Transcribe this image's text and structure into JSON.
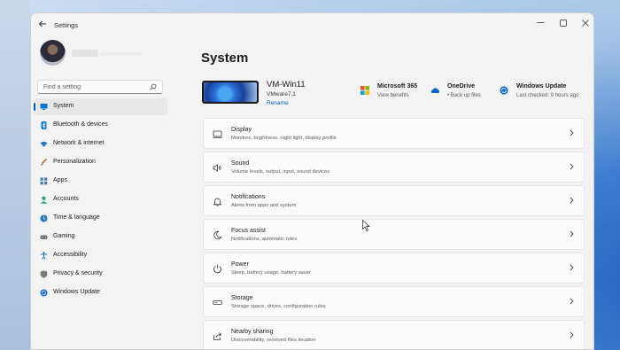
{
  "window": {
    "title": "Settings",
    "controls": {
      "minimize": "—",
      "maximize": "▢",
      "close": "✕"
    }
  },
  "search": {
    "placeholder": "Find a setting"
  },
  "sidebar": {
    "items": [
      {
        "label": "System",
        "icon": "monitor-icon",
        "color": "#0078d4",
        "selected": true
      },
      {
        "label": "Bluetooth & devices",
        "icon": "bluetooth-icon",
        "color": "#0078d4"
      },
      {
        "label": "Network & internet",
        "icon": "wifi-icon",
        "color": "#2b78c5"
      },
      {
        "label": "Personalization",
        "icon": "brush-icon",
        "color": "#c0703a"
      },
      {
        "label": "Apps",
        "icon": "apps-icon",
        "color": "#4a7cb8"
      },
      {
        "label": "Accounts",
        "icon": "account-icon",
        "color": "#2aa37a"
      },
      {
        "label": "Time & language",
        "icon": "globe-clock-icon",
        "color": "#2b78c5"
      },
      {
        "label": "Gaming",
        "icon": "gamepad-icon",
        "color": "#6b6b6b"
      },
      {
        "label": "Accessibility",
        "icon": "accessibility-icon",
        "color": "#1f6fb5"
      },
      {
        "label": "Privacy & security",
        "icon": "shield-icon",
        "color": "#7a7a7a"
      },
      {
        "label": "Windows Update",
        "icon": "windows-update-icon",
        "color": "#1f6fd0"
      }
    ]
  },
  "main": {
    "title": "System",
    "device": {
      "name": "VM-Win11",
      "model": "VMware7,1",
      "rename_label": "Rename"
    },
    "quick_links": [
      {
        "title": "Microsoft 365",
        "subtitle": "View benefits",
        "icon": "microsoft-365-icon"
      },
      {
        "title": "OneDrive",
        "subtitle": "• Back up files",
        "icon": "onedrive-icon"
      },
      {
        "title": "Windows Update",
        "subtitle": "Last checked: 9 hours ago",
        "icon": "windows-update-icon"
      }
    ],
    "cards": [
      {
        "title": "Display",
        "subtitle": "Monitors, brightness, night light, display profile",
        "icon": "display-icon"
      },
      {
        "title": "Sound",
        "subtitle": "Volume levels, output, input, sound devices",
        "icon": "speaker-icon"
      },
      {
        "title": "Notifications",
        "subtitle": "Alerts from apps and system",
        "icon": "bell-icon"
      },
      {
        "title": "Focus assist",
        "subtitle": "Notifications, automatic rules",
        "icon": "moon-icon"
      },
      {
        "title": "Power",
        "subtitle": "Sleep, battery usage, battery saver",
        "icon": "power-icon"
      },
      {
        "title": "Storage",
        "subtitle": "Storage space, drives, configuration rules",
        "icon": "storage-icon"
      },
      {
        "title": "Nearby sharing",
        "subtitle": "Discoverability, received files location",
        "icon": "share-icon"
      }
    ]
  },
  "colors": {
    "accent": "#005fb8",
    "window_bg": "#f3f3f3",
    "card_bg": "#fbfbfb"
  }
}
